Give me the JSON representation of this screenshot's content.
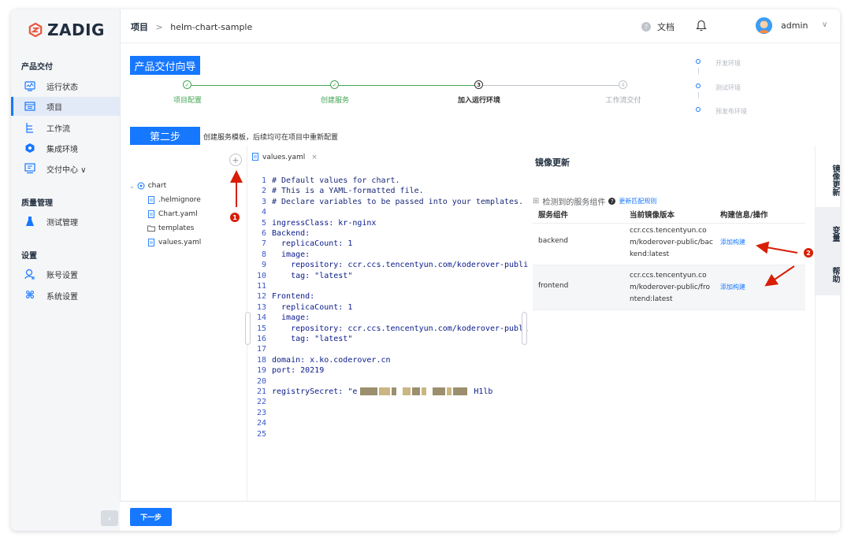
{
  "brand": {
    "name": "ZADIG",
    "color": "#1677ff"
  },
  "sidebar": {
    "section_delivery": "产品交付",
    "items": [
      {
        "label": "运行状态",
        "icon": "monitor-icon"
      },
      {
        "label": "项目",
        "icon": "project-icon",
        "active": true
      },
      {
        "label": "工作流",
        "icon": "workflow-icon"
      },
      {
        "label": "集成环境",
        "icon": "environment-icon"
      },
      {
        "label": "交付中心 ∨",
        "icon": "delivery-center-icon"
      }
    ],
    "section_quality": "质量管理",
    "quality_items": [
      {
        "label": "测试管理",
        "icon": "test-tube-icon"
      }
    ],
    "section_settings": "设置",
    "settings_items": [
      {
        "label": "账号设置",
        "icon": "account-icon"
      },
      {
        "label": "系统设置",
        "icon": "command-icon"
      }
    ],
    "collapse": "‹"
  },
  "header": {
    "breadcrumb_root": "项目",
    "breadcrumb_sep": ">",
    "breadcrumb_current": "helm-chart-sample",
    "docs": "文档",
    "user": "admin"
  },
  "wizard": {
    "title": "产品交付向导",
    "steps": [
      {
        "label": "项目配置",
        "state": "done",
        "mark": "✓"
      },
      {
        "label": "创建服务",
        "state": "done",
        "mark": "✓"
      },
      {
        "label": "加入运行环境",
        "state": "current",
        "mark": "3"
      },
      {
        "label": "工作流交付",
        "state": "todo",
        "mark": "4"
      }
    ],
    "environments": [
      "开发环境",
      "测试环境",
      "预发布环境"
    ],
    "step_badge": "第二步",
    "step_desc": "创建服务模板，后续均可在项目中重新配置"
  },
  "tree": {
    "add": "+",
    "root": "chart",
    "children": [
      ".helmignore",
      "Chart.yaml",
      "templates",
      "values.yaml"
    ]
  },
  "editor": {
    "tab": "values.yaml",
    "close": "×",
    "lines": [
      "# Default values for chart.",
      "# This is a YAML-formatted file.",
      "# Declare variables to be passed into your templates.",
      "",
      "ingressClass: kr-nginx",
      "Backend:",
      "  replicaCount: 1",
      "  image:",
      "    repository: ccr.ccs.tencentyun.com/koderover-publi",
      "    tag: \"latest\"",
      "",
      "Frontend:",
      "  replicaCount: 1",
      "  image:",
      "    repository: ccr.ccs.tencentyun.com/koderover-publi",
      "    tag: \"latest\"",
      "",
      "domain: x.ko.coderover.cn",
      "port: 20219",
      "",
      "registrySecret: \"e",
      "",
      "",
      "",
      ""
    ],
    "secret_tail": "H1lb"
  },
  "image_panel": {
    "title": "镜像更新",
    "detected": "检测到的服务组件",
    "help": "?",
    "rule_link": "更新匹配规则",
    "columns": [
      "服务组件",
      "当前镜像版本",
      "构建信息/操作"
    ],
    "rows": [
      {
        "service": "backend",
        "image": "ccr.ccs.tencentyun.com/koderover-public/backend:latest",
        "action": "添加构建"
      },
      {
        "service": "frontend",
        "image": "ccr.ccs.tencentyun.com/koderover-public/frontend:latest",
        "action": "添加构建"
      }
    ]
  },
  "right_tabs": [
    "镜像更新",
    "变量",
    "帮助"
  ],
  "footer": {
    "next": "下一步"
  },
  "annotations": {
    "one": "1",
    "two": "2",
    "color": "#d81e06"
  }
}
